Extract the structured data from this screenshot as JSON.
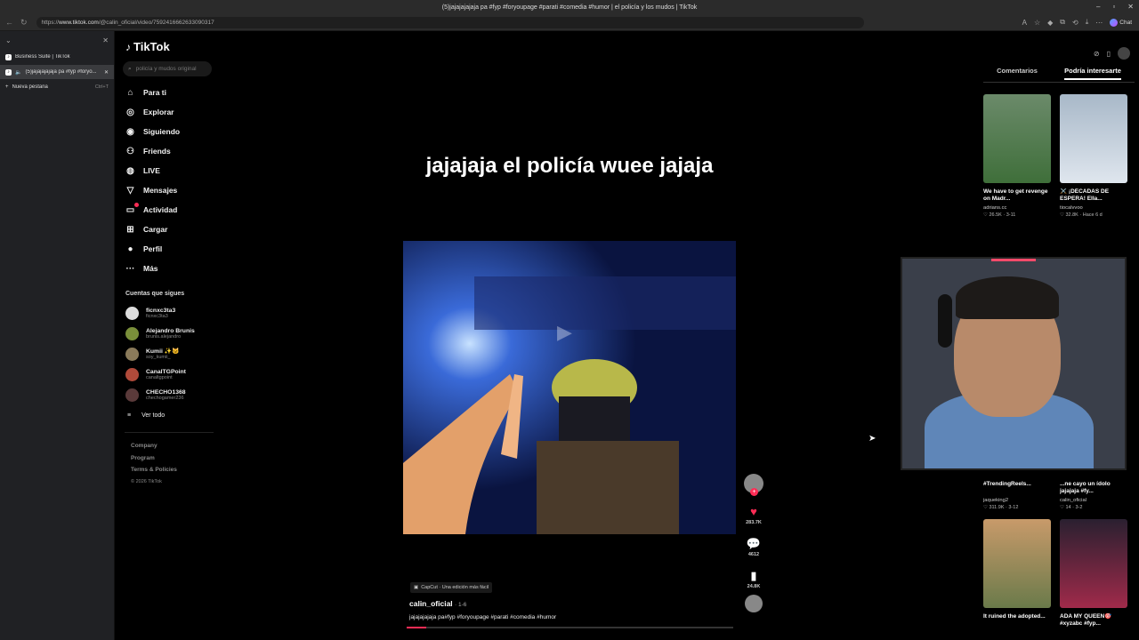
{
  "window": {
    "title": "(5)jajajajajaja pa #fyp #foryoupage #parati #comedia #humor | el policía y los mudos | TikTok"
  },
  "browser": {
    "url_prefix": "https://",
    "url_host": "www.tiktok.com",
    "url_path": "/@calin_oficial/video/7592416662633090317",
    "chat_label": "Chat"
  },
  "vertical_tabs": {
    "tabs": [
      {
        "label": "Business Suite | TikTok",
        "active": false
      },
      {
        "label": "(5)jajajajajaja pa #fyp #foryo...",
        "active": true
      }
    ],
    "new_tab_label": "Nueva pestaña",
    "new_tab_shortcut": "Ctrl+T"
  },
  "tiktok": {
    "logo_text": "TikTok",
    "search_placeholder": "policía y mudos original",
    "menu": [
      {
        "label": "Para ti",
        "icon": "home-icon"
      },
      {
        "label": "Explorar",
        "icon": "compass-icon"
      },
      {
        "label": "Siguiendo",
        "icon": "following-icon"
      },
      {
        "label": "Friends",
        "icon": "friends-icon"
      },
      {
        "label": "LIVE",
        "icon": "live-icon"
      },
      {
        "label": "Mensajes",
        "icon": "send-icon"
      },
      {
        "label": "Actividad",
        "icon": "activity-icon"
      },
      {
        "label": "Cargar",
        "icon": "upload-icon"
      },
      {
        "label": "Perfil",
        "icon": "profile-icon"
      },
      {
        "label": "Más",
        "icon": "more-icon"
      }
    ],
    "following_title": "Cuentas que sigues",
    "following": [
      {
        "name": "ficnxc3ta3",
        "handle": "ficnxc3ta3"
      },
      {
        "name": "Alejandro Brunis",
        "handle": "brunis.alejandro"
      },
      {
        "name": "Kumii ✨🐱",
        "handle": "soy_kumii_"
      },
      {
        "name": "CanalTGPoint",
        "handle": "canaltgpoint"
      },
      {
        "name": "CHECHO1368",
        "handle": "chechogamer236"
      }
    ],
    "see_all": "Ver todo",
    "footer": [
      "Company",
      "Program",
      "Terms & Policies"
    ],
    "copyright": "© 2026 TikTok"
  },
  "video": {
    "caption_overlay": "jajajaja el policía wuee jajaja",
    "capcut_label": "CapCut · Una edición más fácil",
    "author": "calin_oficial",
    "date": "· 1-6",
    "description": "jajajajajaja pa#fyp #foryoupage #parati #comedia #humor",
    "likes": "283.7K",
    "comments": "4612",
    "saves": "24.8K",
    "progress_fraction": 0.06
  },
  "right_panel": {
    "tabs": [
      "Comentarios",
      "Podría interesarte"
    ],
    "active_tab": 1,
    "cards": [
      {
        "title": "We have to get revenge on Madr...",
        "user": "adrians.cc",
        "stats": "♡ 26.5K · 3-11"
      },
      {
        "title": "⚔️ ¡DÉCADAS DE ESPERA! Ella...",
        "user": "tiocalvvoo",
        "stats": "♡ 32.8K · Hace 6 d"
      },
      {
        "title": "#TrendingReels...",
        "user": "jaqueking2",
        "stats": "♡ 311.9K · 3-12"
      },
      {
        "title": "...ne cayo un ídolo jajajaja #fy...",
        "user": "calin_oficial",
        "stats": "♡ 14 · 3-2"
      },
      {
        "title": "It ruined the adopted...",
        "user": "",
        "stats": ""
      },
      {
        "title": "ADA MY QUEEN🎯 #xyzabc #fyp...",
        "user": "",
        "stats": ""
      }
    ]
  },
  "colors": {
    "accent": "#fe2c55",
    "background": "#000000"
  }
}
